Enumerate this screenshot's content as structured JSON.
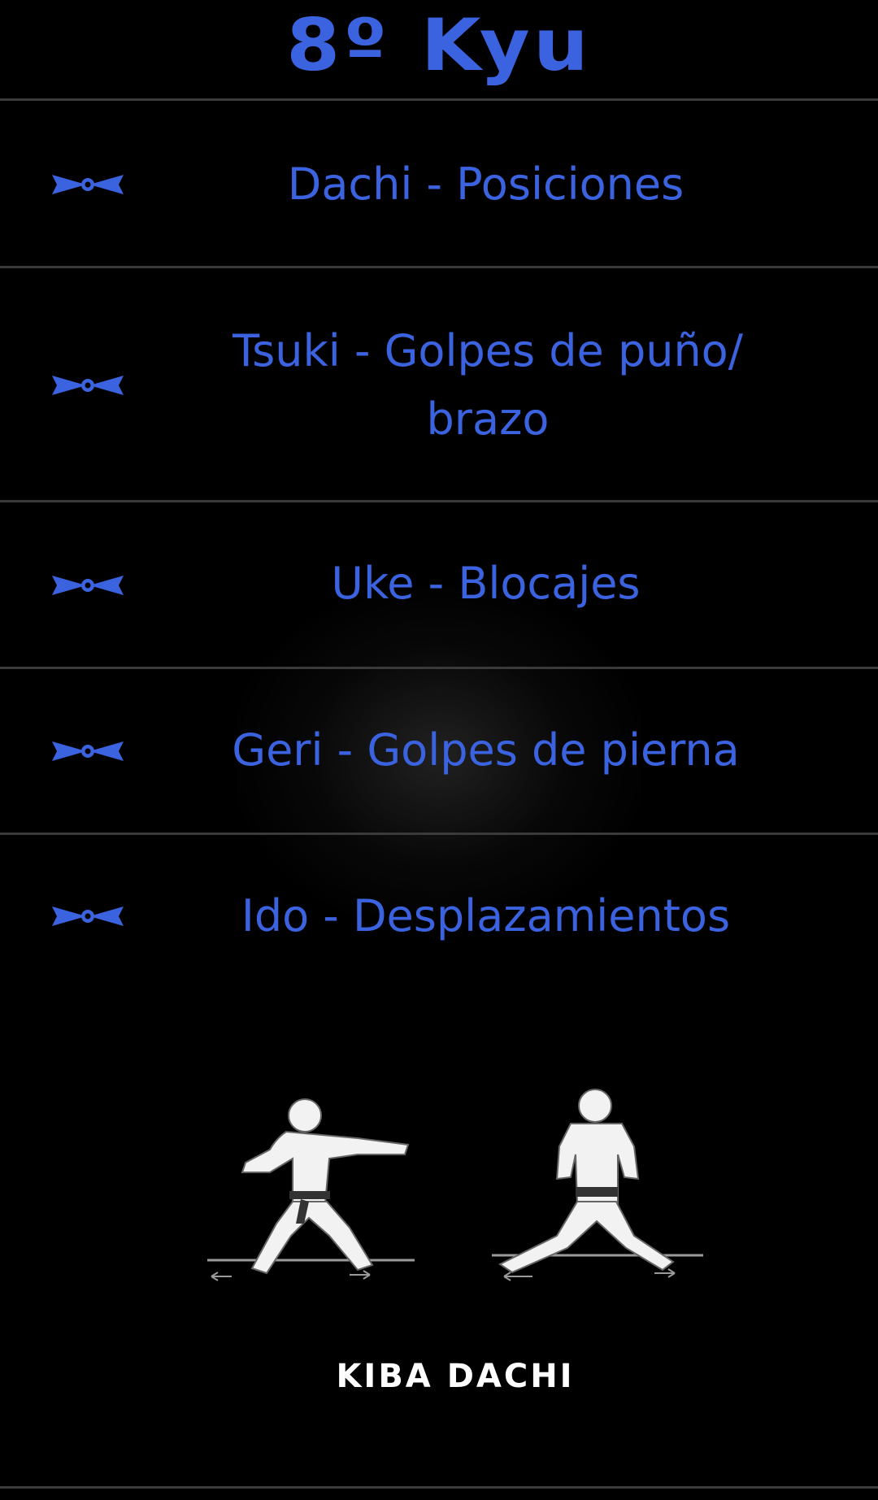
{
  "header": {
    "title": "8º Kyu"
  },
  "menu": {
    "items": [
      {
        "label": "Dachi - Posiciones",
        "icon": "belt-icon"
      },
      {
        "label": "Tsuki - Golpes de puño/ brazo",
        "icon": "belt-icon"
      },
      {
        "label": "Uke - Blocajes",
        "icon": "belt-icon"
      },
      {
        "label": "Geri - Golpes de pierna",
        "icon": "belt-icon"
      },
      {
        "label": "Ido - Desplazamientos",
        "icon": "belt-icon"
      }
    ]
  },
  "figure": {
    "caption": "KIBA DACHI"
  },
  "colors": {
    "accent": "#3b63e0",
    "background": "#000000",
    "divider": "#3a3a3a"
  }
}
